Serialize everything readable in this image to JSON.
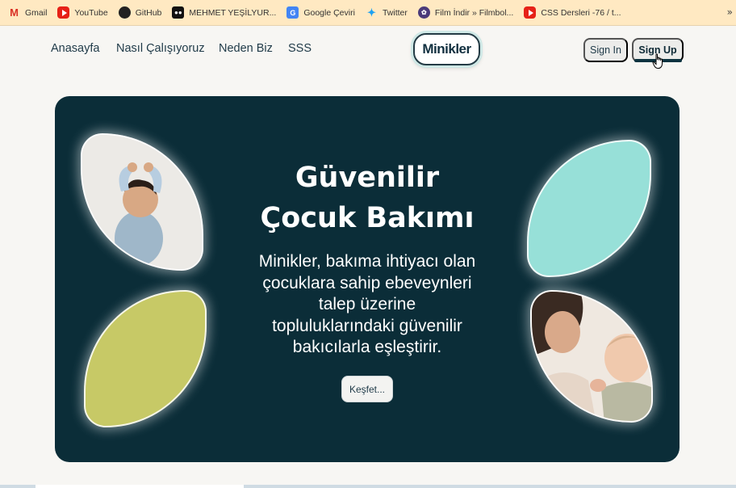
{
  "bookmarks": [
    {
      "label": "Gmail",
      "icon": "gmail-icon"
    },
    {
      "label": "YouTube",
      "icon": "youtube-icon"
    },
    {
      "label": "GitHub",
      "icon": "github-icon"
    },
    {
      "label": "MEHMET YEŞİLYUR...",
      "icon": "medium-icon"
    },
    {
      "label": "Google Çeviri",
      "icon": "google-translate-icon"
    },
    {
      "label": "Twitter",
      "icon": "twitter-icon"
    },
    {
      "label": "Film İndir » Filmbol...",
      "icon": "film-icon"
    },
    {
      "label": "CSS Dersleri -76 / t...",
      "icon": "youtube-icon"
    }
  ],
  "more_bookmarks": "»",
  "nav": {
    "links": [
      "Anasayfa",
      "Nasıl Çalışıyoruz",
      "Neden Biz",
      "SSS"
    ],
    "logo": "Minikler",
    "sign_in": "Sign In",
    "sign_up": "Sign Up"
  },
  "hero": {
    "title_line1": "Güvenilir",
    "title_line2": "Çocuk Bakımı",
    "text_lines": [
      "Minikler, bakıma ihtiyacı olan",
      "çocuklara sahip ebeveynleri",
      "talep üzerine",
      "topluluklarındaki güvenilir",
      "bakıcılarla eşleştirir."
    ],
    "button": "Keşfet..."
  },
  "colors": {
    "hero_bg": "#0b2d38",
    "petal_olive": "#c7c966",
    "petal_teal": "#97e0d8",
    "page_bg": "#f7f6f3",
    "bookmarks_bg": "#ffe9c2"
  }
}
